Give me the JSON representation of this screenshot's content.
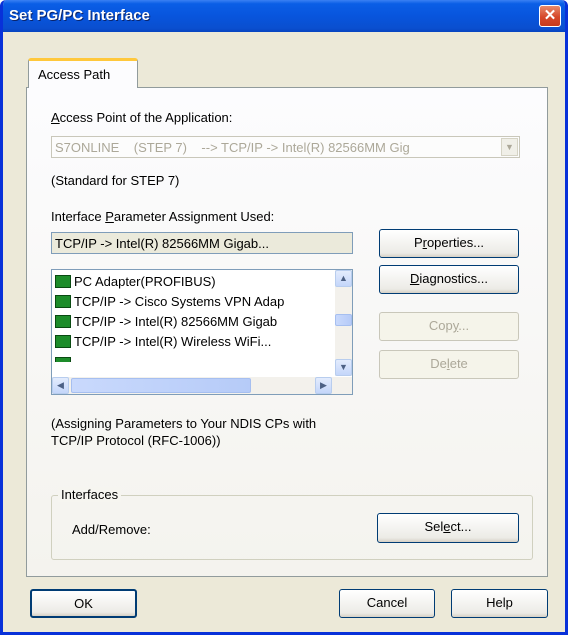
{
  "window": {
    "title": "Set PG/PC Interface",
    "close_label": "✕"
  },
  "tab": {
    "label": "Access Path"
  },
  "access_point": {
    "label": "Access Point of the Application:",
    "value": "S7ONLINE    (STEP 7)    --> TCP/IP -> Intel(R) 82566MM Gig",
    "note": "(Standard for STEP 7)"
  },
  "parameter": {
    "label": "Interface Parameter Assignment Used:",
    "value": "TCP/IP -> Intel(R) 82566MM Gigab..."
  },
  "interface_list": [
    {
      "label": "PC Adapter(PROFIBUS)"
    },
    {
      "label": "TCP/IP -> Cisco Systems VPN Adap"
    },
    {
      "label": "TCP/IP -> Intel(R) 82566MM Gigab"
    },
    {
      "label": "TCP/IP -> Intel(R) Wireless WiFi..."
    }
  ],
  "buttons": {
    "properties": "Properties...",
    "diagnostics": "Diagnostics...",
    "copy": "Copy...",
    "delete": "Delete",
    "select": "Select...",
    "ok": "OK",
    "cancel": "Cancel",
    "help": "Help"
  },
  "description": "(Assigning Parameters to Your NDIS CPs with TCP/IP Protocol (RFC-1006))",
  "interfaces_group": {
    "title": "Interfaces",
    "add_remove_label": "Add/Remove:"
  },
  "scrollbar_glyphs": {
    "up": "▲",
    "down": "▼",
    "left": "◀",
    "right": "▶"
  },
  "icons": [
    "close-icon",
    "network-adapter-icon",
    "dropdown-arrow-icon"
  ]
}
